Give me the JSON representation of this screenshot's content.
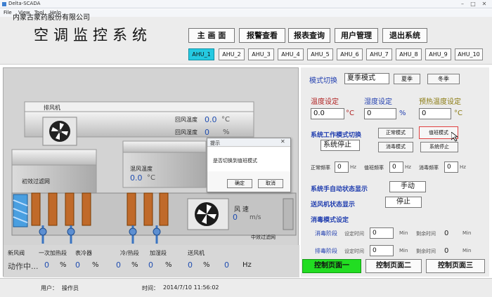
{
  "window": {
    "title": "Delta-SCADA"
  },
  "menu": [
    "File",
    "View",
    "Tool",
    "Help"
  ],
  "header": {
    "company": "内蒙古蒙药股份有限公司",
    "title": "空调监控系统",
    "nav": [
      "主 画 面",
      "报警查看",
      "报表查询",
      "用户管理",
      "退出系统"
    ],
    "ahu_tabs": [
      "AHU_1",
      "AHU_2",
      "AHU_3",
      "AHU_4",
      "AHU_5",
      "AHU_6",
      "AHU_7",
      "AHU_8",
      "AHU_9",
      "AHU_10"
    ],
    "active_ahu": "AHU_1"
  },
  "left": {
    "exhaust_label": "排风机",
    "return_temp_label": "回风温度",
    "return_temp_value": "0.0",
    "return_temp_unit": "°C",
    "return_hum_label": "回风湿度",
    "return_hum_value": "0",
    "return_hum_unit": "%",
    "mixed_temp_label": "混风温度",
    "mixed_temp_value": "0.0",
    "mixed_temp_unit": "°C",
    "primary_filter_label": "初效过滤网",
    "wind_speed_label": "风 速",
    "wind_speed_value": "0",
    "wind_speed_unit": "m/s",
    "mid_filter_label": "中效过滤网",
    "section_labels": [
      "新风阀",
      "一次加热段",
      "表冷器",
      "冷/热段",
      "加湿段",
      "送风机"
    ],
    "status_text": "动作中...",
    "bottom_values": [
      {
        "value": "0",
        "unit": "%"
      },
      {
        "value": "0",
        "unit": "%"
      },
      {
        "value": "0",
        "unit": "%"
      },
      {
        "value": "0",
        "unit": "%"
      },
      {
        "value": "0",
        "unit": "%"
      },
      {
        "value": "0",
        "unit": "Hz"
      }
    ]
  },
  "right": {
    "mode_switch_label": "模式切换",
    "season_value": "夏季模式",
    "summer_btn": "夏季",
    "winter_btn": "冬季",
    "temp_set_label": "温度设定",
    "temp_set_value": "0.0",
    "temp_unit": "°C",
    "hum_set_label": "湿度设定",
    "hum_set_value": "0",
    "hum_unit": "%",
    "preheat_label": "预热温度设定",
    "preheat_value": "0",
    "preheat_unit": "°C",
    "work_mode_label": "系统工作模式切换",
    "normal_mode_btn": "正常模式",
    "duty_mode_btn": "值班模式",
    "disinfect_mode_btn": "消毒模式",
    "stop_btn": "系统停止",
    "system_status": "系统停止",
    "freq_normal_label": "正常频率",
    "freq_normal_value": "0",
    "freq_duty_label": "值班频率",
    "freq_duty_value": "0",
    "freq_disinfect_label": "消毒频率",
    "freq_disinfect_value": "0",
    "hz": "Hz",
    "auto_state_label": "系统手自动状态显示",
    "auto_state_value": "手动",
    "fan_state_label": "送风机状态显示",
    "fan_state_value": "停止",
    "disinfect_setting_label": "消毒模式设定",
    "disinfect_stage_label": "消毒阶段",
    "exhaust_stage_label": "排毒阶段",
    "set_time_label": "设定时间",
    "remain_time_label": "剩余时间",
    "set_time_value": "0",
    "remain_time_value": "0",
    "min": "Min",
    "ctrl_pages": [
      "控制页面一",
      "控制页面二",
      "控制页面三"
    ]
  },
  "footer": {
    "user_label": "用户：",
    "user_value": "操作员",
    "time_label": "时间：",
    "time_value": "2014/7/10 11:56:02"
  },
  "dialog": {
    "title": "提示",
    "message": "是否切换到值班模式",
    "ok": "确定",
    "cancel": "取消"
  },
  "colors": {
    "accent": "#25c9e1",
    "active_page": "#22dd22",
    "label_red": "#b02222",
    "label_blue": "#2340b0",
    "label_olive": "#8a7a10",
    "highlight_border": "#e04040"
  }
}
